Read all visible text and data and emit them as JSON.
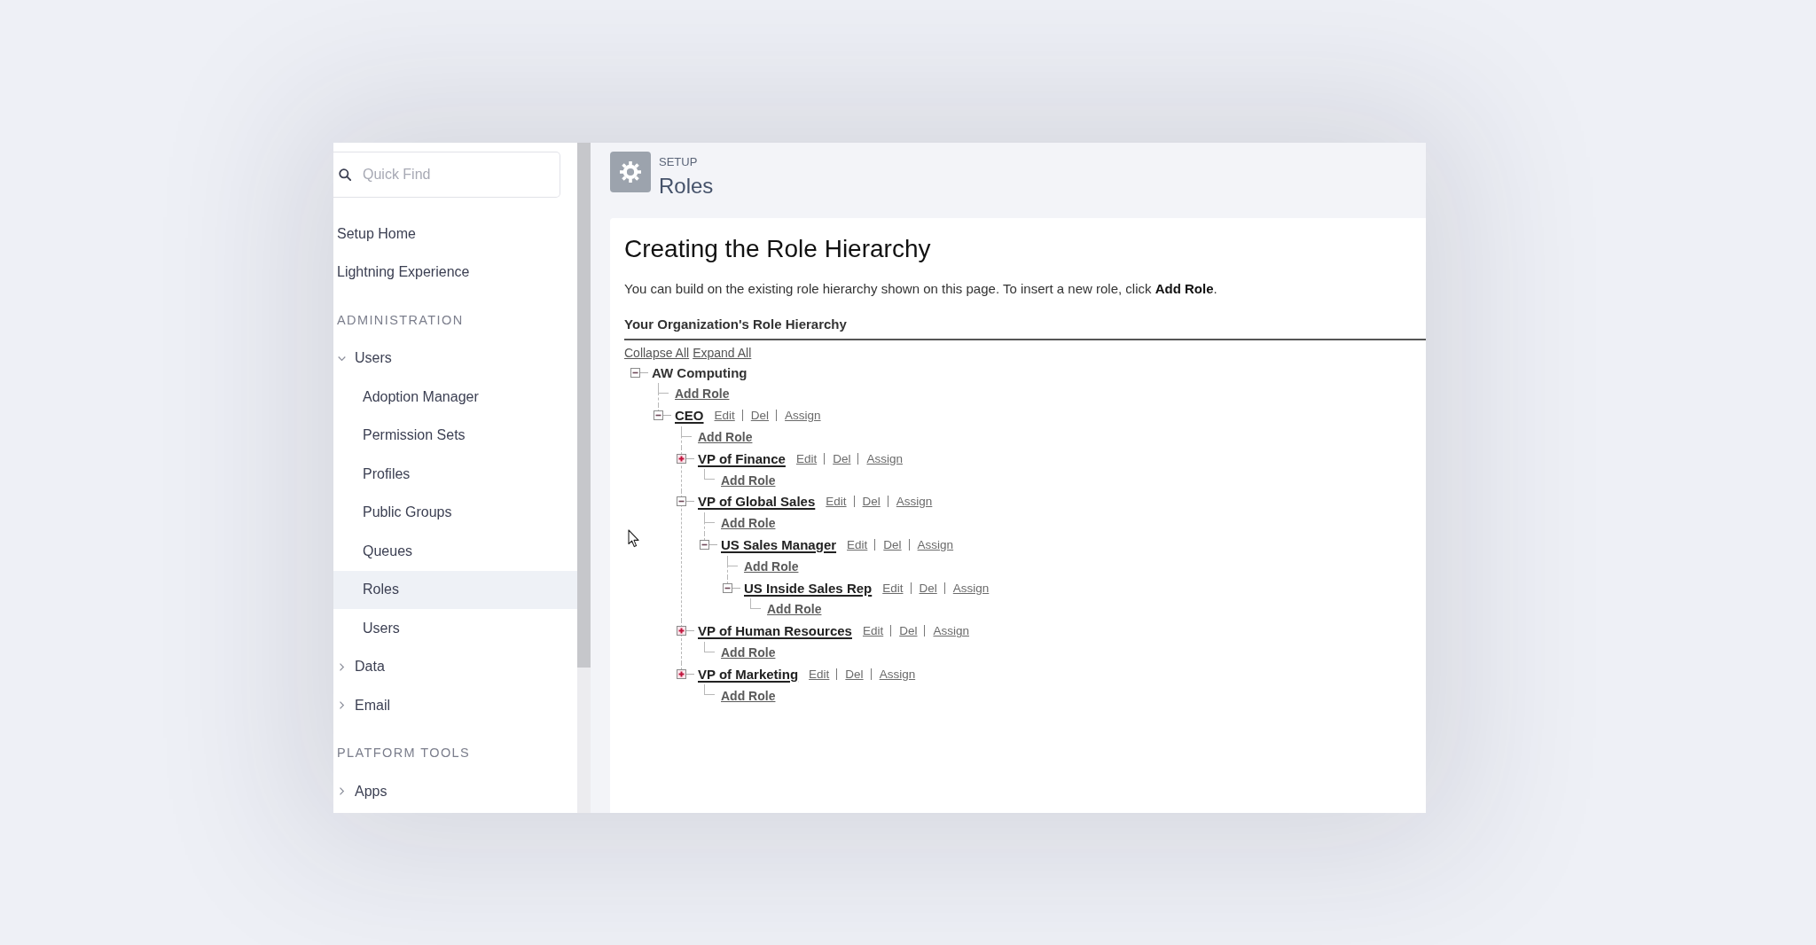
{
  "sidebar": {
    "search": {
      "placeholder": "Quick Find"
    },
    "items": [
      {
        "kind": "link",
        "label": "Setup Home",
        "selected": false
      },
      {
        "kind": "link",
        "label": "Lightning Experience",
        "selected": false
      },
      {
        "kind": "heading",
        "label": "ADMINISTRATION"
      },
      {
        "kind": "group",
        "label": "Users",
        "expanded": true,
        "children": [
          {
            "label": "Adoption Manager",
            "selected": false
          },
          {
            "label": "Permission Sets",
            "selected": false
          },
          {
            "label": "Profiles",
            "selected": false
          },
          {
            "label": "Public Groups",
            "selected": false
          },
          {
            "label": "Queues",
            "selected": false
          },
          {
            "label": "Roles",
            "selected": true
          },
          {
            "label": "Users",
            "selected": false
          }
        ]
      },
      {
        "kind": "group",
        "label": "Data",
        "expanded": false
      },
      {
        "kind": "group",
        "label": "Email",
        "expanded": false
      },
      {
        "kind": "heading",
        "label": "PLATFORM TOOLS"
      },
      {
        "kind": "group",
        "label": "Apps",
        "expanded": false
      }
    ]
  },
  "header": {
    "eyebrow": "SETUP",
    "title": "Roles"
  },
  "content": {
    "title": "Creating the Role Hierarchy",
    "intro": "You can build on the existing role hierarchy shown on this page. To insert a new role, click **Add Role**.",
    "hierarchy": {
      "heading": "Your Organization's Role Hierarchy",
      "collapse_all": "Collapse All",
      "expand_all": "Expand All",
      "tree": {
        "label": "AW Computing",
        "expanded": true,
        "add_role": "Add Role",
        "children": [
          {
            "label": "CEO",
            "expanded": true,
            "actions": [
              "Edit",
              "Del",
              "Assign"
            ],
            "add_role": "Add Role",
            "children": [
              {
                "label": "VP of Finance",
                "expanded": false,
                "actions": [
                  "Edit",
                  "Del",
                  "Assign"
                ],
                "add_role": "Add Role"
              },
              {
                "label": "VP of Global Sales",
                "expanded": true,
                "actions": [
                  "Edit",
                  "Del",
                  "Assign"
                ],
                "add_role": "Add Role",
                "children": [
                  {
                    "label": "US Sales Manager",
                    "expanded": true,
                    "actions": [
                      "Edit",
                      "Del",
                      "Assign"
                    ],
                    "add_role": "Add Role",
                    "children": [
                      {
                        "label": "US Inside Sales Rep",
                        "expanded": true,
                        "actions": [
                          "Edit",
                          "Del",
                          "Assign"
                        ],
                        "add_role": "Add Role"
                      }
                    ]
                  }
                ]
              },
              {
                "label": "VP of Human Resources",
                "expanded": false,
                "actions": [
                  "Edit",
                  "Del",
                  "Assign"
                ],
                "add_role": "Add Role"
              },
              {
                "label": "VP of Marketing",
                "expanded": false,
                "actions": [
                  "Edit",
                  "Del",
                  "Assign"
                ],
                "add_role": "Add Role"
              }
            ]
          }
        ]
      }
    }
  }
}
